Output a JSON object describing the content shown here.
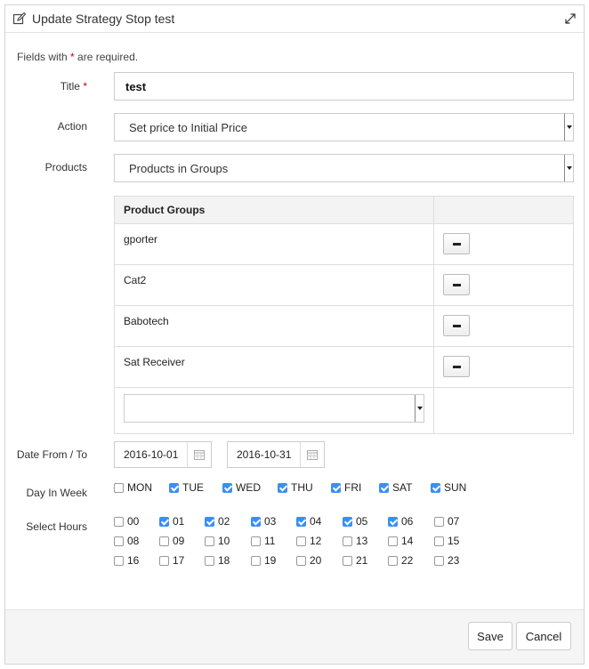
{
  "dialog": {
    "title": "Update Strategy Stop test",
    "icons": {
      "edit": "edit-icon",
      "expand": "expand-icon"
    }
  },
  "form": {
    "required_note_prefix": "Fields with ",
    "required_star": "*",
    "required_note_suffix": " are required.",
    "title_label": "Title",
    "title_value": "test",
    "action_label": "Action",
    "action_value": "Set price to Initial Price",
    "products_label": "Products",
    "products_value": "Products in Groups",
    "groups_header": "Product Groups",
    "groups": [
      "gporter",
      "Cat2",
      "Babotech",
      "Sat Receiver"
    ],
    "group_add_value": "",
    "date_label": "Date From / To",
    "date_from": "2016-10-01",
    "date_to": "2016-10-31",
    "day_label": "Day In Week",
    "days": [
      {
        "label": "MON",
        "checked": false
      },
      {
        "label": "TUE",
        "checked": true
      },
      {
        "label": "WED",
        "checked": true
      },
      {
        "label": "THU",
        "checked": true
      },
      {
        "label": "FRI",
        "checked": true
      },
      {
        "label": "SAT",
        "checked": true
      },
      {
        "label": "SUN",
        "checked": true
      }
    ],
    "hours_label": "Select Hours",
    "hours": [
      {
        "label": "00",
        "checked": false
      },
      {
        "label": "01",
        "checked": true
      },
      {
        "label": "02",
        "checked": true
      },
      {
        "label": "03",
        "checked": true
      },
      {
        "label": "04",
        "checked": true
      },
      {
        "label": "05",
        "checked": true
      },
      {
        "label": "06",
        "checked": true
      },
      {
        "label": "07",
        "checked": false
      },
      {
        "label": "08",
        "checked": false
      },
      {
        "label": "09",
        "checked": false
      },
      {
        "label": "10",
        "checked": false
      },
      {
        "label": "11",
        "checked": false
      },
      {
        "label": "12",
        "checked": false
      },
      {
        "label": "13",
        "checked": false
      },
      {
        "label": "14",
        "checked": false
      },
      {
        "label": "15",
        "checked": false
      },
      {
        "label": "16",
        "checked": false
      },
      {
        "label": "17",
        "checked": false
      },
      {
        "label": "18",
        "checked": false
      },
      {
        "label": "19",
        "checked": false
      },
      {
        "label": "20",
        "checked": false
      },
      {
        "label": "21",
        "checked": false
      },
      {
        "label": "22",
        "checked": false
      },
      {
        "label": "23",
        "checked": false
      }
    ]
  },
  "footer": {
    "save_label": "Save",
    "cancel_label": "Cancel"
  },
  "colors": {
    "checkbox_checked": "#3b8ff0",
    "required_star": "#cc0000"
  }
}
